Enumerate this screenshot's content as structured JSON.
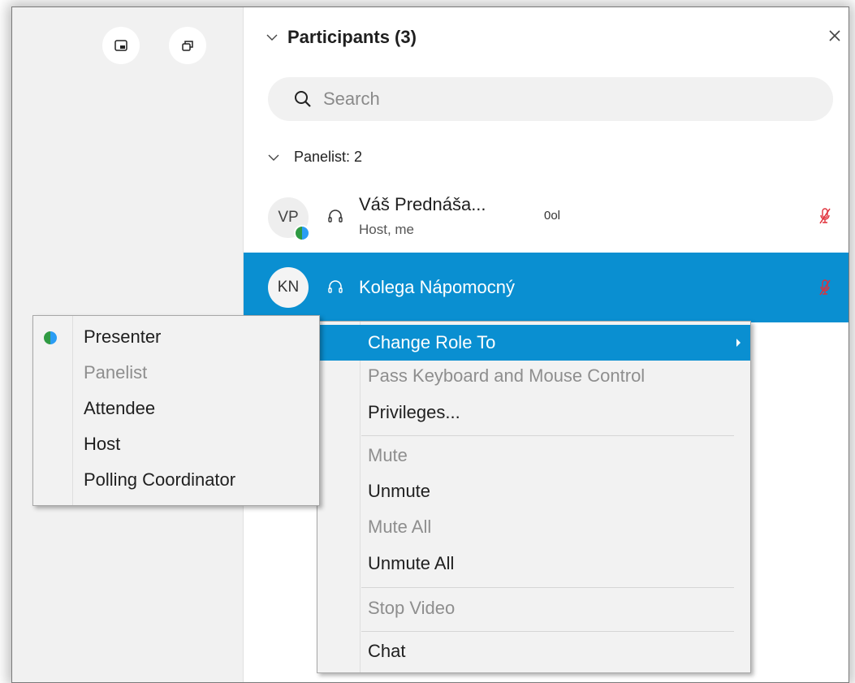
{
  "panel": {
    "title": "Participants (3)",
    "search_placeholder": "Search",
    "group_label": "Panelist: 2"
  },
  "participants": [
    {
      "initials": "VP",
      "name": "Váš Prednáša...",
      "subtitle": "Host, me",
      "audio_level": "0ol"
    },
    {
      "initials": "KN",
      "name": "Kolega Nápomocný"
    }
  ],
  "context_menu": {
    "items": [
      {
        "label": "Change Role To",
        "state": "highlighted",
        "has_submenu": true
      },
      {
        "label": "Pass Keyboard and Mouse Control",
        "state": "disabled"
      },
      {
        "label": "Privileges...",
        "state": "enabled"
      },
      {
        "label": "Mute",
        "state": "disabled"
      },
      {
        "label": "Unmute",
        "state": "enabled"
      },
      {
        "label": "Mute All",
        "state": "disabled"
      },
      {
        "label": "Unmute All",
        "state": "enabled"
      },
      {
        "label": "Stop Video",
        "state": "disabled"
      },
      {
        "label": "Chat",
        "state": "enabled"
      }
    ]
  },
  "role_submenu": {
    "items": [
      {
        "label": "Presenter",
        "state": "enabled",
        "icon": "presenter-ball-icon"
      },
      {
        "label": "Panelist",
        "state": "disabled"
      },
      {
        "label": "Attendee",
        "state": "enabled"
      },
      {
        "label": "Host",
        "state": "enabled"
      },
      {
        "label": "Polling Coordinator",
        "state": "enabled"
      }
    ]
  },
  "colors": {
    "selection": "#0a8fd1",
    "muted_mic": "#e0303a",
    "presenter_blue": "#2a9df4",
    "presenter_green": "#2f9a43"
  },
  "icons": [
    "picture-in-picture-icon",
    "popout-windows-icon",
    "chevron-down-icon",
    "close-icon",
    "search-icon",
    "headset-icon",
    "muted-mic-icon",
    "chevron-right-icon"
  ]
}
